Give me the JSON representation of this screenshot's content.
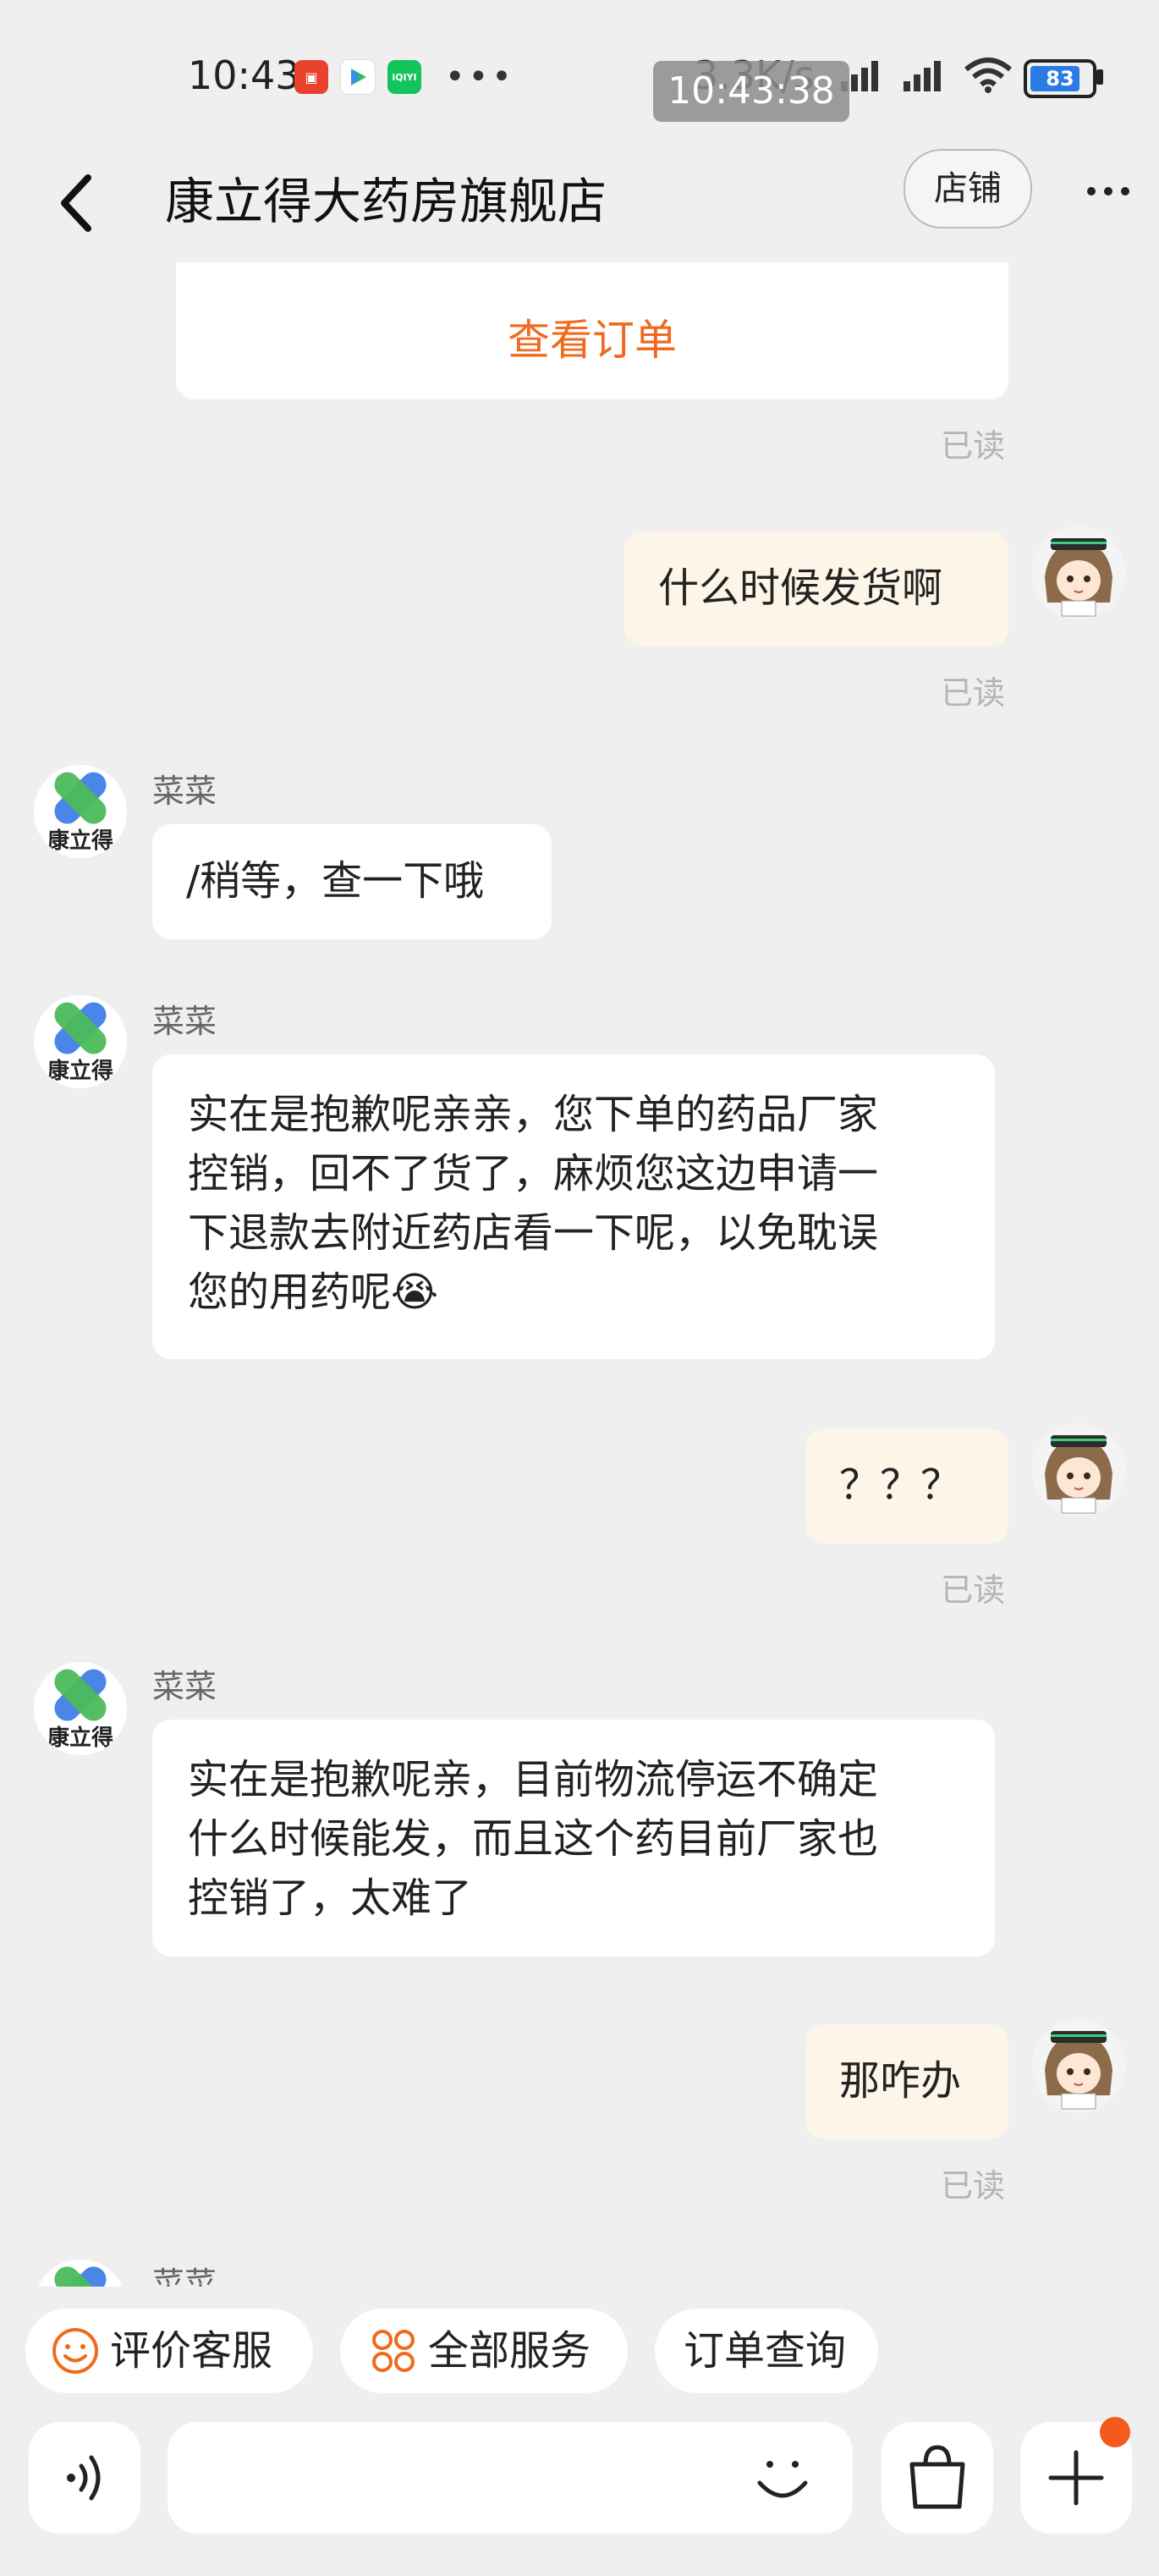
{
  "status_bar": {
    "time": "10:43",
    "overlay_time": "10:43:38",
    "network_speed": "3.3K/s",
    "battery": "83",
    "more_dots": "•••"
  },
  "header": {
    "title": "康立得大药房旗舰店",
    "shop_button": "店铺"
  },
  "chat": {
    "order_link": "查看订单",
    "read_label": "已读",
    "messages": [
      {
        "from": "me",
        "text": "什么时候发货啊"
      },
      {
        "from": "shop",
        "sender": "菜菜",
        "text": "/稍等，查一下哦"
      },
      {
        "from": "shop",
        "sender": "菜菜",
        "lines": [
          "实在是抱歉呢亲亲，您下单的药品厂家",
          "控销，回不了货了，麻烦您这边申请一",
          "下退款去附近药店看一下呢，以免耽误",
          "您的用药呢"
        ],
        "emoji": "😭"
      },
      {
        "from": "me",
        "text": "？？？"
      },
      {
        "from": "shop",
        "sender": "菜菜",
        "lines": [
          "实在是抱歉呢亲，目前物流停运不确定",
          "什么时候能发，而且这个药目前厂家也",
          "控销了，太难了"
        ]
      },
      {
        "from": "me",
        "text": "那咋办"
      },
      {
        "from": "shop",
        "sender": "菜菜"
      }
    ]
  },
  "quick_actions": {
    "rate_service": "评价客服",
    "all_services": "全部服务",
    "order_query": "订单查询"
  },
  "input": {
    "placeholder": ""
  },
  "colors": {
    "accent": "#f06a1e",
    "my_bubble": "#fdf6e8",
    "background": "#efefef"
  }
}
